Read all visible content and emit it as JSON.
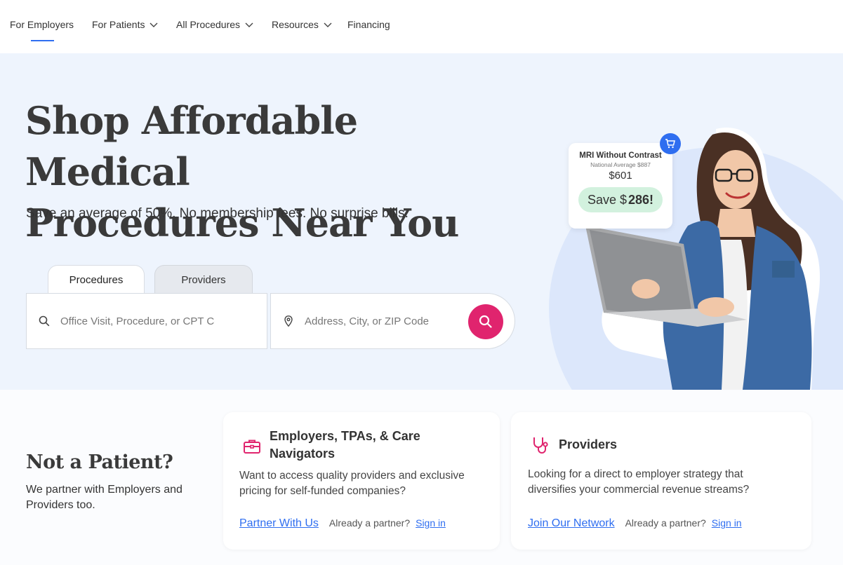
{
  "nav": {
    "items": [
      {
        "label": "For Employers"
      },
      {
        "label": "For Patients"
      },
      {
        "label": "All Procedures"
      },
      {
        "label": "Resources"
      },
      {
        "label": "Financing"
      }
    ]
  },
  "hero": {
    "title_line1": "Shop Affordable Medical",
    "title_line2": "Procedures Near You",
    "subtitle": "Save an average of 50%. No membership fees. No surprise bills.",
    "tabs": [
      {
        "label": "Procedures"
      },
      {
        "label": "Providers"
      }
    ],
    "search": {
      "procedure_placeholder": "Office Visit, Procedure, or CPT Code",
      "location_placeholder": "Address, City, or ZIP Code"
    },
    "price_card": {
      "title": "MRI Without Contrast",
      "national_avg": "National Average $887",
      "price": "$601",
      "save_prefix": "Save $",
      "save_amount": "286!"
    }
  },
  "not_patient": {
    "title": "Not a Patient?",
    "subtitle": "We partner with Employers and Providers too."
  },
  "cards": {
    "employers": {
      "title": "Employers, TPAs, & Care Navigators",
      "body": "Want to access quality providers and exclusive pricing for self-funded companies?",
      "link": "Partner With Us",
      "already": "Already a partner?",
      "signin": "Sign in"
    },
    "providers": {
      "title": "Providers",
      "body": "Looking for a direct to employer strategy that diversifies your commercial revenue streams?",
      "link": "Join Our Network",
      "already": "Already a partner?",
      "signin": "Sign in"
    }
  },
  "colors": {
    "accent_blue": "#2f6ef0",
    "search_pink": "#e0246e",
    "hero_bg": "#eef4fd",
    "save_green": "#d2f1de"
  }
}
